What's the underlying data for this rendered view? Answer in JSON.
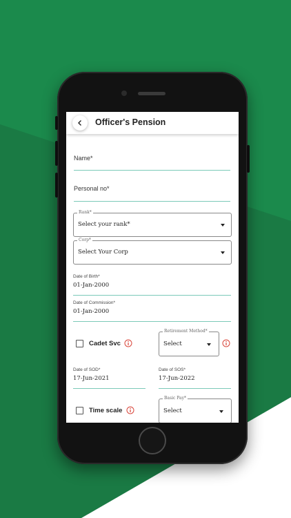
{
  "app": {
    "title": "Officer's Pension"
  },
  "form": {
    "name_label": "Name*",
    "personal_no_label": "Personal no*",
    "rank": {
      "label": "Rank*",
      "value": "Select your rank*"
    },
    "corp": {
      "label": "Corp*",
      "value": "Select Your Corp"
    },
    "dob": {
      "label": "Date of Birth*",
      "value": "01-Jan-2000"
    },
    "doc": {
      "label": "Date of Commission*",
      "value": "01-Jan-2000"
    },
    "cadet_svc": {
      "label": "Cadet Svc"
    },
    "retirement_method": {
      "label": "Retirement Method*",
      "value": "Select"
    },
    "sod": {
      "label": "Date of SOD*",
      "value": "17-Jun-2021"
    },
    "sos": {
      "label": "Date of SOS*",
      "value": "17-Jun-2022"
    },
    "time_scale": {
      "label": "Time scale"
    },
    "basic_pay": {
      "label": "Basic Pay*",
      "value": "Select"
    }
  },
  "colors": {
    "brand_green": "#1b8a4c",
    "dark_green": "#1a7a44",
    "field_underline": "#7ac9b8",
    "info_red": "#d9463b"
  },
  "icons": {
    "back": "chevron-left-icon",
    "dropdown": "caret-down-icon",
    "info": "info-circle-icon"
  }
}
